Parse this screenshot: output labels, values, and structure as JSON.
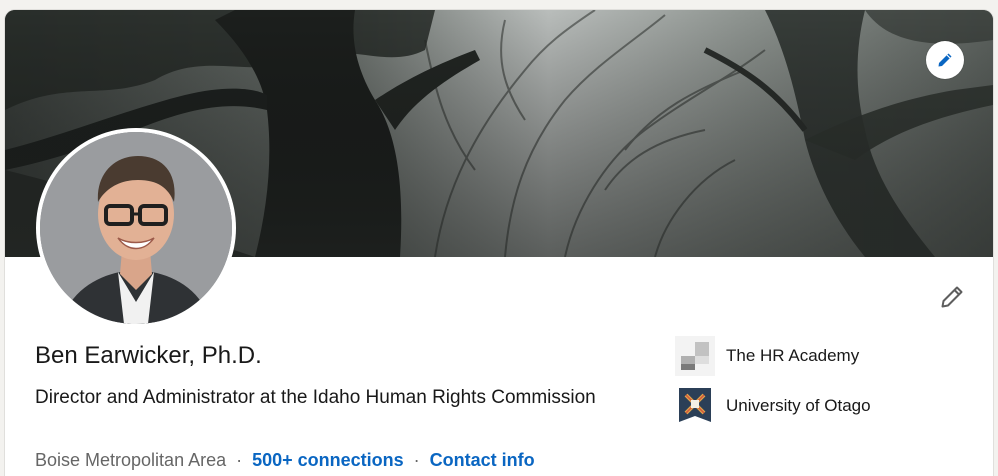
{
  "profile": {
    "name": "Ben Earwicker, Ph.D.",
    "headline": "Director and Administrator at the Idaho Human Rights Commission",
    "location": "Boise Metropolitan Area",
    "separator": "·",
    "connections": "500+ connections",
    "contact_info": "Contact info"
  },
  "organizations": [
    {
      "name": "The HR Academy",
      "logo": "hr-academy-logo"
    },
    {
      "name": "University of Otago",
      "logo": "university-of-otago-crest"
    }
  ],
  "icons": {
    "banner_edit": "pencil-icon",
    "profile_edit": "pencil-icon"
  },
  "colors": {
    "accent": "#0a66c2",
    "text": "#191919",
    "muted": "#666666"
  }
}
